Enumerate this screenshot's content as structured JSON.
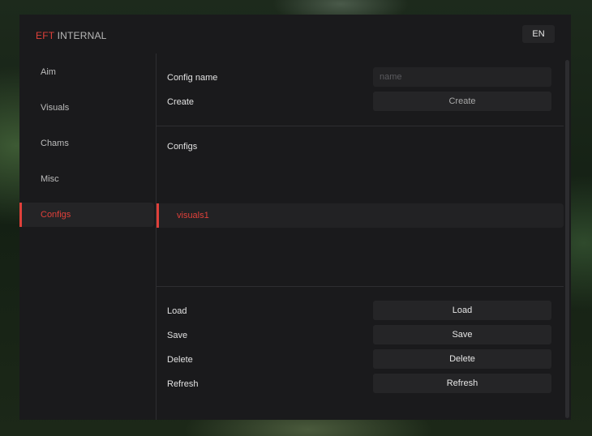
{
  "brand": {
    "prefix": "EFT",
    "suffix": "INTERNAL"
  },
  "language": "EN",
  "sidebar": {
    "items": [
      {
        "label": "Aim"
      },
      {
        "label": "Visuals"
      },
      {
        "label": "Chams"
      },
      {
        "label": "Misc"
      },
      {
        "label": "Configs",
        "active": true
      }
    ]
  },
  "config_name": {
    "label": "Config name",
    "placeholder": "name",
    "value": ""
  },
  "create": {
    "label": "Create",
    "button": "Create"
  },
  "configs": {
    "header": "Configs",
    "items": [
      {
        "name": "visuals1",
        "selected": true
      }
    ]
  },
  "actions": [
    {
      "label": "Load",
      "button": "Load"
    },
    {
      "label": "Save",
      "button": "Save"
    },
    {
      "label": "Delete",
      "button": "Delete"
    },
    {
      "label": "Refresh",
      "button": "Refresh"
    }
  ],
  "colors": {
    "accent": "#e0403a",
    "panel": "#1a1a1c",
    "control": "#252527"
  }
}
